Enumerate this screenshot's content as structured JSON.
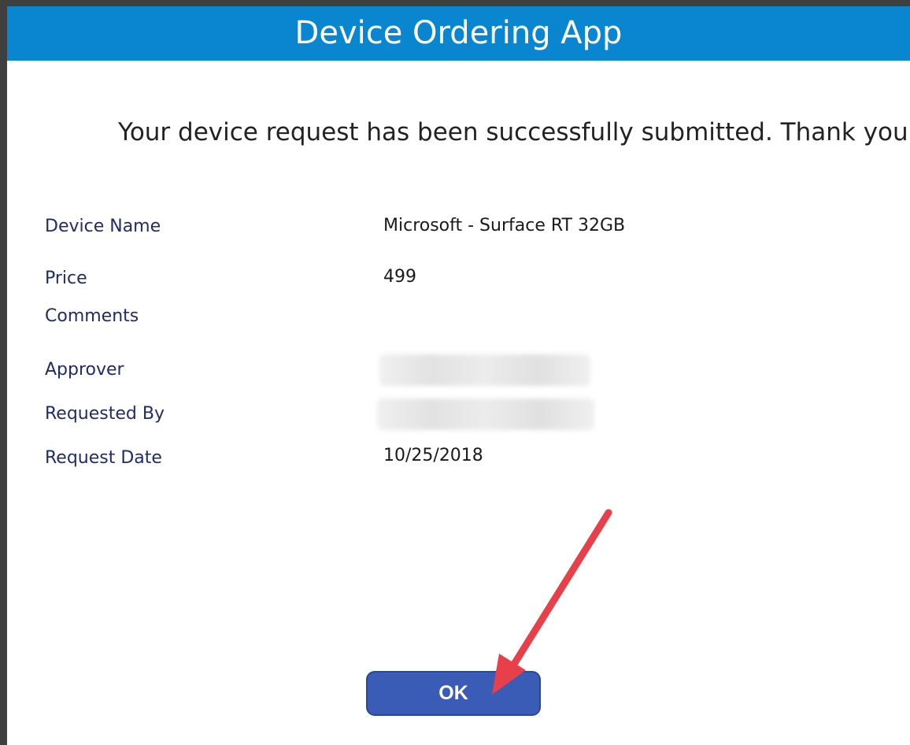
{
  "app": {
    "title": "Device Ordering App"
  },
  "confirmation": {
    "message": "Your device request has been successfully submitted. Thank you."
  },
  "details": {
    "device_name": {
      "label": "Device Name",
      "value": "Microsoft - Surface RT 32GB"
    },
    "price": {
      "label": "Price",
      "value": "499"
    },
    "comments": {
      "label": "Comments",
      "value": ""
    },
    "approver": {
      "label": "Approver",
      "value": ""
    },
    "requested_by": {
      "label": "Requested By",
      "value": ""
    },
    "request_date": {
      "label": "Request Date",
      "value": "10/25/2018"
    }
  },
  "actions": {
    "ok_label": "OK"
  },
  "colors": {
    "header_bg": "#0a86d0",
    "label_text": "#1f2b6e",
    "button_bg": "#3a5cb6",
    "annotation_arrow": "#e8404a"
  },
  "icons": {
    "annotation": "red-arrow-icon"
  }
}
